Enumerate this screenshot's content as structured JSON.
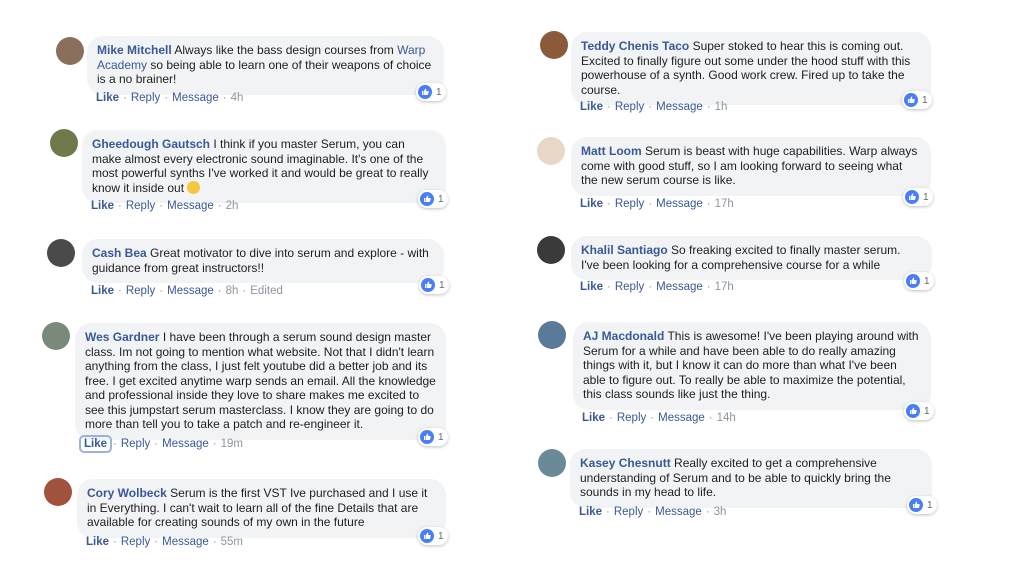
{
  "comments": [
    {
      "name": "Mike Mitchell",
      "text_pre": " Always like the bass design courses from ",
      "link": "Warp Academy",
      "text_post": " so being able to learn one of their weapons of choice is a no brainer!",
      "actions": [
        "Like",
        "Reply",
        "Message"
      ],
      "time": "4h",
      "reactions": "1",
      "avatar_color": "#8a6f5c"
    },
    {
      "name": "Gheedough Gautsch",
      "text": " I think if you master Serum, you can make almost every electronic sound imaginable. It's one of the most powerful synths I've worked it and would be great to really know it inside out",
      "emoji": "grinning-face-emoji",
      "actions": [
        "Like",
        "Reply",
        "Message"
      ],
      "time": "2h",
      "reactions": "1",
      "avatar_color": "#6e7a4a"
    },
    {
      "name": "Cash Bea",
      "text": " Great motivator to dive into serum and explore - with guidance from great instructors!!",
      "actions": [
        "Like",
        "Reply",
        "Message"
      ],
      "time": "8h",
      "edited": "Edited",
      "reactions": "1",
      "avatar_color": "#4a4a4a"
    },
    {
      "name": "Wes Gardner",
      "text": " I have been through a serum sound design master class. Im not going to mention what website. Not that I didn't learn anything from the class, I just felt youtube did a better job and its free. I get excited anytime warp sends an email. All the knowledge and professional inside they love to share makes me excited to see this jumpstart serum masterclass. I know they are going to do more than tell you to take a patch and re-engineer it.",
      "actions": [
        "Like",
        "Reply",
        "Message"
      ],
      "time": "19m",
      "reactions": "1",
      "avatar_color": "#7a8a7a"
    },
    {
      "name": "Cory Wolbeck",
      "text": " Serum is the first VST Ive purchased and I use it in Everything. I can't wait to learn all of the fine Details that are available for creating sounds of my own in the future",
      "actions": [
        "Like",
        "Reply",
        "Message"
      ],
      "time": "55m",
      "reactions": "1",
      "avatar_color": "#a0523c"
    },
    {
      "name": "Teddy Chenis Taco",
      "text": " Super stoked to hear this is coming out. Excited to finally figure out some under the hood stuff with this powerhouse of a synth. Good work crew. Fired up to take the course.",
      "actions": [
        "Like",
        "Reply",
        "Message"
      ],
      "time": "1h",
      "reactions": "1",
      "avatar_color": "#8a5a3a"
    },
    {
      "name": "Matt Loom",
      "text": " Serum is beast with huge capabilities. Warp always come with good stuff, so I am looking forward to seeing what the new serum course is like.",
      "actions": [
        "Like",
        "Reply",
        "Message"
      ],
      "time": "17h",
      "reactions": "1",
      "avatar_color": "#e8d8c8"
    },
    {
      "name": "Khalil Santiago",
      "text": " So freaking excited to finally master serum. I've been looking for a comprehensive course for a while",
      "actions": [
        "Like",
        "Reply",
        "Message"
      ],
      "time": "17h",
      "reactions": "1",
      "avatar_color": "#3a3a3a"
    },
    {
      "name": "AJ Macdonald",
      "text": " This is awesome! I've been playing around with Serum for a while and have been able to do really amazing things with it, but I know it can do more than what I've been able to figure out. To really be able to maximize the potential, this class sounds like just the thing.",
      "actions": [
        "Like",
        "Reply",
        "Message"
      ],
      "time": "14h",
      "reactions": "1",
      "avatar_color": "#5a7a9a"
    },
    {
      "name": "Kasey Chesnutt",
      "text": " Really excited to get a comprehensive understanding of Serum and to be able to quickly bring the sounds in my head to life.",
      "actions": [
        "Like",
        "Reply",
        "Message"
      ],
      "time": "3h",
      "reactions": "1",
      "avatar_color": "#6a8a9a"
    }
  ]
}
